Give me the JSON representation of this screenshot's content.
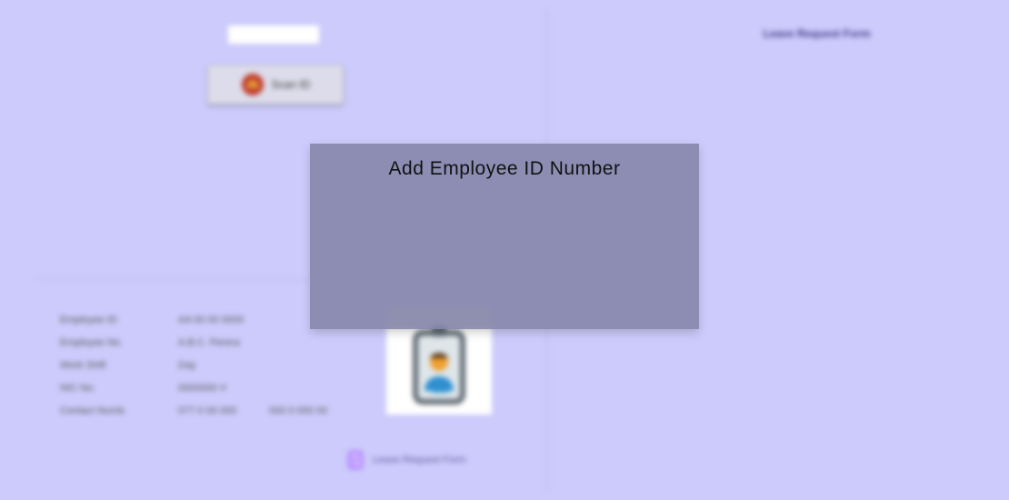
{
  "left_panel": {
    "id_input_value": "",
    "scan_button_label": "Scan ID",
    "employee_info": [
      {
        "label": "Employee ID",
        "value": "AA 00 00 0000",
        "value2": ""
      },
      {
        "label": "Employee No.",
        "value": "A.B.C. Perera",
        "value2": ""
      },
      {
        "label": "Work Shift",
        "value": "Day",
        "value2": ""
      },
      {
        "label": "NIC No.",
        "value": "0000000 V",
        "value2": ""
      },
      {
        "label": "Contact Numb.",
        "value": "077 0 00 000",
        "value2": "000 0 000 00"
      }
    ],
    "leave_link_label": "Leave Request Form"
  },
  "right_panel": {
    "title": "Leave Request Form"
  },
  "modal": {
    "title": "Add Employee ID Number"
  },
  "colors": {
    "background": "#cdcbfb",
    "modal_overlay": "#8484aa",
    "accent": "#3a3a86"
  },
  "icons": {
    "scan": "fingerprint-icon",
    "photo": "id-badge-icon",
    "leave": "document-icon"
  }
}
